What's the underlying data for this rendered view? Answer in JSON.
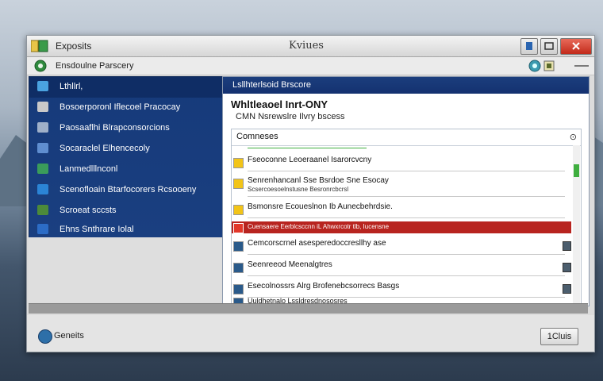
{
  "window": {
    "app_title": "Exposits",
    "title": "Kviues"
  },
  "menubar": {
    "title": "Ensdoulne Parscery"
  },
  "sidebar": {
    "items": [
      {
        "label": "Lthllrl,",
        "value": "",
        "icon": "list-icon",
        "color": "#4aa3e0"
      },
      {
        "label": "Bosoerporonl Iflecoel Pracocay",
        "value": "",
        "icon": "document-icon",
        "color": "#c9c9c9"
      },
      {
        "label": "Paosaaflhi Blrapconsorcions",
        "value": "",
        "icon": "grid-icon",
        "color": "#9fb0c9"
      },
      {
        "label": "Socaraclel Elhencecoly",
        "value": "",
        "icon": "page-icon",
        "color": "#5f8ed0"
      },
      {
        "label": "Lanmedlllnconl",
        "value": "",
        "icon": "badge-icon",
        "color": "#3a9c5a"
      },
      {
        "label": "Scenofloain Btarfocorers Rcsooeny",
        "value": "",
        "icon": "monitor-icon",
        "color": "#2b84d6"
      },
      {
        "label": "Scroeat sccsts",
        "value": "",
        "icon": "leaf-icon",
        "color": "#4c8a3a"
      },
      {
        "label": "Ehns Snthrare Iolal",
        "value": "",
        "icon": "panel-icon",
        "color": "#2c6cc6"
      }
    ]
  },
  "panel": {
    "header": "Lsllhterlsoid Brscore",
    "heading": "Whltleaoel Inrt-ONY",
    "subheading": "CMN Nsrewslre Ilvry bscess",
    "components": {
      "title": "Comneses",
      "rows": [
        {
          "text": "",
          "sub": "",
          "state": "plain"
        },
        {
          "text": "Fseoconne Leoeraanel Isarorcvcny",
          "sub": "",
          "state": "warn"
        },
        {
          "text": "Senrenhancanl Sse Bsrdoe Sne Esocay",
          "sub": "Scsercoesoelnstusne Besronrcbcrsl",
          "state": "warn"
        },
        {
          "text": "Bsmonsre Ecoueslnon Ib Aunecbehrdsie.",
          "sub": "",
          "state": "warn"
        },
        {
          "text": "Cuensaere Eerblcsccnn iL Ahwxrcotr tlb, Iucensne",
          "sub": "",
          "state": "error"
        },
        {
          "text": "Cemcorscrnel asesperedoccresllhy ase",
          "sub": "",
          "state": "info"
        },
        {
          "text": "Seenreeod Meenalgtres",
          "sub": "",
          "state": "info"
        },
        {
          "text": "Esecolnossrs Alrg Brofenebcsorrecs Basgs",
          "sub": "",
          "state": "info"
        },
        {
          "text": "Uuldhetnalo Lssldresdnososres",
          "sub": "",
          "state": "checked"
        }
      ]
    }
  },
  "footer": {
    "settings_label": "Geneits",
    "close_label": "1Cluis"
  }
}
